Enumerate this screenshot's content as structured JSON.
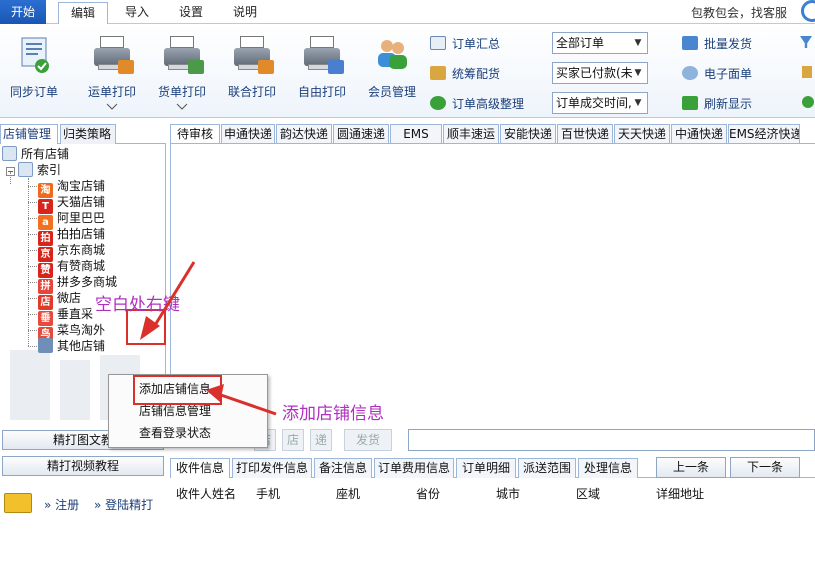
{
  "menu": {
    "start": "开始",
    "tabs": [
      "编辑",
      "导入",
      "设置",
      "说明"
    ],
    "right_text": "包教包会，找客服"
  },
  "ribbon": {
    "sync": "同步订单",
    "buttons": [
      "运单打印",
      "货单打印",
      "联合打印",
      "自由打印",
      "会员管理"
    ],
    "side_links": [
      "订单汇总",
      "统筹配货",
      "订单高级整理"
    ],
    "filters": [
      "全部订单",
      "买家已付款(未",
      "订单成交时间,"
    ],
    "right_links": [
      "批量发货",
      "电子面单",
      "刷新显示"
    ]
  },
  "left_panel": {
    "tabs": [
      "店铺管理",
      "归类策略"
    ],
    "root": "所有店铺",
    "index": "索引",
    "shops": [
      {
        "label": "淘宝店铺",
        "glyph": "淘",
        "color": "#f06a1d"
      },
      {
        "label": "天猫店铺",
        "glyph": "T",
        "color": "#d9241b"
      },
      {
        "label": "阿里巴巴",
        "glyph": "a",
        "color": "#f37021"
      },
      {
        "label": "拍拍店铺",
        "glyph": "拍",
        "color": "#d9241b"
      },
      {
        "label": "京东商城",
        "glyph": "京",
        "color": "#d9241b"
      },
      {
        "label": "有赞商城",
        "glyph": "赞",
        "color": "#d9241b"
      },
      {
        "label": "拼多多商城",
        "glyph": "拼",
        "color": "#e6463a"
      },
      {
        "label": "微店",
        "glyph": "店",
        "color": "#e03b2a"
      },
      {
        "label": "垂直采",
        "glyph": "垂",
        "color": "#e64a3a"
      },
      {
        "label": "菜鸟淘外",
        "glyph": "鸟",
        "color": "#e64a3a"
      },
      {
        "label": "其他店铺",
        "glyph": "",
        "color": "#6f8fb8"
      }
    ],
    "btn_image_tutorial": "精打图文教",
    "btn_video_tutorial": "精打视频教程",
    "register": "注册",
    "login": "登陆精打"
  },
  "courier_tabs": [
    "待审核",
    "申通快递",
    "韵达快递",
    "圆通速递",
    "EMS",
    "顺丰速运",
    "安能快递",
    "百世快递",
    "天天快递",
    "中通快递",
    "EMS经济快递"
  ],
  "toolbar2": {
    "ghost1": "店",
    "ghost2": "店",
    "ghost3": "递",
    "ship": "发货"
  },
  "detail_tabs": [
    "收件信息",
    "打印发件信息",
    "备注信息",
    "订单费用信息",
    "订单明细",
    "派送范围",
    "处理信息"
  ],
  "nav": {
    "prev": "上一条",
    "next": "下一条"
  },
  "detail_columns": [
    "收件人姓名",
    "手机",
    "座机",
    "省份",
    "城市",
    "区域",
    "详细地址"
  ],
  "context_menu": [
    "添加店铺信息",
    "店铺信息管理",
    "查看登录状态"
  ],
  "annotations": {
    "right_click": "空白处右键",
    "add_shop": "添加店铺信息"
  },
  "colors": {
    "accent": "#1a56b4",
    "annotation_text": "#b02fc0",
    "annotation_red": "#d9302b"
  }
}
